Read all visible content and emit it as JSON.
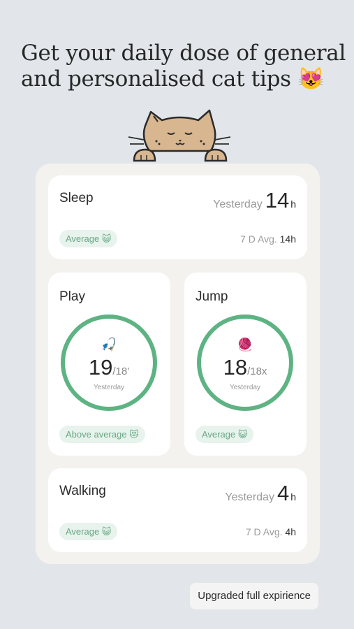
{
  "headline": {
    "line1": "Get your daily dose of general",
    "line2": "and personalised cat tips 😻"
  },
  "mascot": {
    "icon": "cat-mascot-icon"
  },
  "sleep": {
    "title": "Sleep",
    "period": "Yesterday",
    "value": "14",
    "unit": "h",
    "badge": "Average 😺",
    "avg_label": "7 D Avg.",
    "avg_value": "14h"
  },
  "play": {
    "title": "Play",
    "icon": "🎣",
    "value": "19",
    "target": "/18'",
    "period": "Yesterday",
    "badge": "Above average 😻"
  },
  "jump": {
    "title": "Jump",
    "icon": "🧶",
    "value": "18",
    "target": "/18x",
    "period": "Yesterday",
    "badge": "Average 😺"
  },
  "walking": {
    "title": "Walking",
    "period": "Yesterday",
    "value": "4",
    "unit": "h",
    "badge": "Average 😺",
    "avg_label": "7 D Avg.",
    "avg_value": "4h"
  },
  "upgrade_button": "Upgraded full expirience",
  "colors": {
    "accent": "#5eb383",
    "badge_bg": "#e7f3ec",
    "background": "#e2e6ea"
  }
}
